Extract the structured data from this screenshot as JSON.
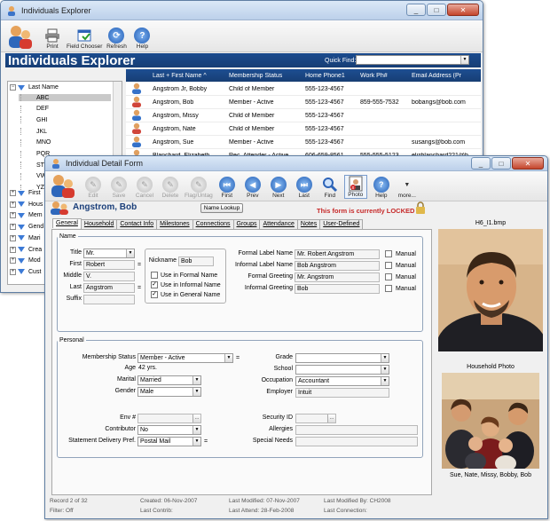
{
  "explorer": {
    "window_title": "Individuals Explorer",
    "toolbar": [
      {
        "label": "Print",
        "icon": "print-icon"
      },
      {
        "label": "Field Chooser",
        "icon": "field-chooser-icon"
      },
      {
        "label": "Refresh",
        "icon": "refresh-icon"
      },
      {
        "label": "Help",
        "icon": "help-icon"
      }
    ],
    "banner_title": "Individuals Explorer",
    "quick_find_label": "Quick Find:",
    "quick_find_value": "",
    "tree": {
      "root": "Last Name",
      "letters": [
        "ABC",
        "DEF",
        "GHI",
        "JKL",
        "MNO",
        "PQR",
        "STU",
        "VWX",
        "YZ"
      ],
      "selected": "ABC",
      "categories": [
        "First",
        "Hous",
        "Mem",
        "Gend",
        "Mari",
        "Crea",
        "Mod",
        "Cust"
      ]
    },
    "columns": [
      "Last + First Name ^",
      "Membership Status",
      "Home Phone1",
      "Work Ph#",
      "Email Address (Pr"
    ],
    "rows": [
      {
        "name": "Angstrom Jr, Bobby",
        "status": "Child of Member",
        "home": "555-123-4567",
        "work": "",
        "email": ""
      },
      {
        "name": "Angstrom, Bob",
        "status": "Member - Active",
        "home": "555-123-4567",
        "work": "859-555-7532",
        "email": "bobangs@bob.com"
      },
      {
        "name": "Angstrom, Missy",
        "status": "Child of Member",
        "home": "555-123-4567",
        "work": "",
        "email": ""
      },
      {
        "name": "Angstrom, Nate",
        "status": "Child of Member",
        "home": "555-123-4567",
        "work": "",
        "email": ""
      },
      {
        "name": "Angstrom, Sue",
        "status": "Member - Active",
        "home": "555-123-4567",
        "work": "",
        "email": "susangs@bob.com"
      },
      {
        "name": "Blanchard, Elizabeth",
        "status": "Rec. Attender - Active",
        "home": "606-659-8561",
        "work": "555-555-5123",
        "email": "elizblanchard221@b"
      }
    ]
  },
  "detail": {
    "window_title": "Individual Detail Form",
    "toolbar": [
      {
        "label": "Edit",
        "icon": "edit-icon",
        "disabled": true
      },
      {
        "label": "Save",
        "icon": "save-icon",
        "disabled": true
      },
      {
        "label": "Cancel",
        "icon": "cancel-icon",
        "disabled": true
      },
      {
        "label": "Delete",
        "icon": "delete-icon",
        "disabled": true
      },
      {
        "label": "Flag/Untag",
        "icon": "flag-icon",
        "disabled": true
      },
      {
        "label": "First",
        "icon": "first-record-icon",
        "disabled": false
      },
      {
        "label": "Prev",
        "icon": "previous-record-icon",
        "disabled": false
      },
      {
        "label": "Next",
        "icon": "next-record-icon",
        "disabled": false
      },
      {
        "label": "Last",
        "icon": "last-record-icon",
        "disabled": false
      },
      {
        "label": "Find",
        "icon": "find-icon",
        "disabled": false
      },
      {
        "label": "Photo",
        "icon": "photo-icon",
        "disabled": false
      },
      {
        "label": "Help",
        "icon": "help-icon",
        "disabled": false
      },
      {
        "label": "more...",
        "icon": "more-icon",
        "disabled": false
      }
    ],
    "person_name": "Angstrom, Bob",
    "name_lookup_button": "Name Lookup",
    "lock_message": "This form is currently LOCKED",
    "tabs": [
      "General",
      "Household",
      "Contact Info",
      "Milestones",
      "Connections",
      "Groups",
      "Attendance",
      "Notes",
      "User-Defined"
    ],
    "active_tab": "General",
    "name_section": {
      "legend": "Name",
      "title_label": "Title",
      "title_value": "Mr.",
      "first_label": "First",
      "first_value": "Robert",
      "middle_label": "Middle",
      "middle_value": "V.",
      "last_label": "Last",
      "last_value": "Angstrom",
      "suffix_label": "Suffix",
      "suffix_value": "",
      "nickname_label": "Nickname",
      "nickname_value": "Bob",
      "use_formal": {
        "label": "Use in Formal Name",
        "checked": false
      },
      "use_informal": {
        "label": "Use in Informal Name",
        "checked": true
      },
      "use_general": {
        "label": "Use in General Name",
        "checked": true
      },
      "formal_label_name_label": "Formal Label Name",
      "formal_label_name_value": "Mr. Robert Angstrom",
      "informal_label_name_label": "Informal Label Name",
      "informal_label_name_value": "Bob Angstrom",
      "formal_greeting_label": "Formal Greeting",
      "formal_greeting_value": "Mr. Angstrom",
      "informal_greeting_label": "Informal Greeting",
      "informal_greeting_value": "Bob",
      "manual_label": "Manual"
    },
    "personal_section": {
      "legend": "Personal",
      "membership_status_label": "Membership Status",
      "membership_status_value": "Member - Active",
      "age_label": "Age",
      "age_value": "42 yrs.",
      "marital_label": "Marital",
      "marital_value": "Married",
      "gender_label": "Gender",
      "gender_value": "Male",
      "env_label": "Env #",
      "env_value": "",
      "contributor_label": "Contributor",
      "contributor_value": "No",
      "statement_label": "Statement Delivery Pref.",
      "statement_value": "Postal Mail",
      "grade_label": "Grade",
      "grade_value": "",
      "school_label": "School",
      "school_value": "",
      "occupation_label": "Occupation",
      "occupation_value": "Accountant",
      "employer_label": "Employer",
      "employer_value": "Intuit",
      "security_id_label": "Security ID",
      "security_id_value": "",
      "allergies_label": "Allergies",
      "allergies_value": "",
      "special_needs_label": "Special Needs",
      "special_needs_value": ""
    },
    "photo_filename": "H6_I1.bmp",
    "household_photo_label": "Household Photo",
    "household_caption": "Sue, Nate, Missy, Bobby, Bob",
    "status_bar": {
      "record": "Record 2 of 32",
      "filter": "Filter: Off",
      "created": "Created: 06-Nov-2007",
      "last_contrib": "Last Contrib:",
      "last_modified": "Last Modified: 07-Nov-2007",
      "last_attend": "Last Attend: 28-Feb-2008",
      "last_modified_by": "Last Modified By: CH2008",
      "last_connection": "Last Connection:"
    }
  },
  "colors": {
    "banner": "#1b4b8e",
    "lock_text": "#c62828",
    "accent": "#3c7ad6"
  }
}
